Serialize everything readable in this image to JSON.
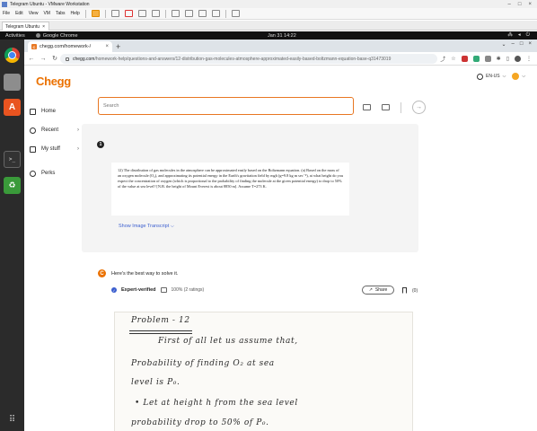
{
  "vmware": {
    "title": "Telegram Ubuntu - VMware Workstation",
    "menu": [
      "File",
      "Edit",
      "View",
      "VM",
      "Tabs",
      "Help"
    ],
    "tab_label": "Telegram Ubuntu",
    "tab_close": "×"
  },
  "ubuntu": {
    "activities": "Activities",
    "app_name": "Google Chrome",
    "clock": "Jan 31  14:22"
  },
  "chrome": {
    "tab_title": "chegg.com/homework-/",
    "tab_close": "×",
    "new_tab": "+",
    "url_host": "chegg.com",
    "url_path": "/homework-help/questions-and-answers/12-distribution-gas-molecules-atmosphere-approximated-easily-based-boltzmann-equation-base-q31473019"
  },
  "page": {
    "logo": "Chegg",
    "lang": "EN-US",
    "nav": [
      {
        "label": "Home"
      },
      {
        "label": "Recent",
        "chevron": "›"
      },
      {
        "label": "My stuff",
        "chevron": "›"
      },
      {
        "label": "Perks"
      }
    ],
    "search_placeholder": "Search",
    "question_number": "1",
    "question_text": "12)  The distribution of gas molecules in the atmosphere can be approximated easily based on the Boltzmann equation. (a) Based on the mass of an oxygen molecule (O₂), and approximating its potential energy in the Earth's gravitation field by mgh (g=9.8 kg m sec⁻²), at what height do you expect the concentration of oxygen (which is proportional to the probability of finding the molecule at the given potential energy) to drop to 50% of the value at sea level? [N.B. the height of Mount Everest is about 8850 m].  Assume T=273 K.",
    "show_transcript": "Show Image Transcript ⌵",
    "answer_intro": "Here's the best way to solve it.",
    "answer_avatar": "C",
    "expert_verified": "Expert-verified",
    "rating": "100% (2 ratings)",
    "share": "Share",
    "bookmark_count": "(0)",
    "handwriting": [
      "Problem - 12",
      "First of all let us assume that,",
      "Probability of finding O₂ at sea",
      "level is P₀.",
      "• Let at height h from the sea level",
      "probability drop to 50% of P₀."
    ]
  },
  "colors": {
    "accent": "#eb7100",
    "link": "#3c5fcf",
    "question_bg": "#f4f4f4"
  }
}
